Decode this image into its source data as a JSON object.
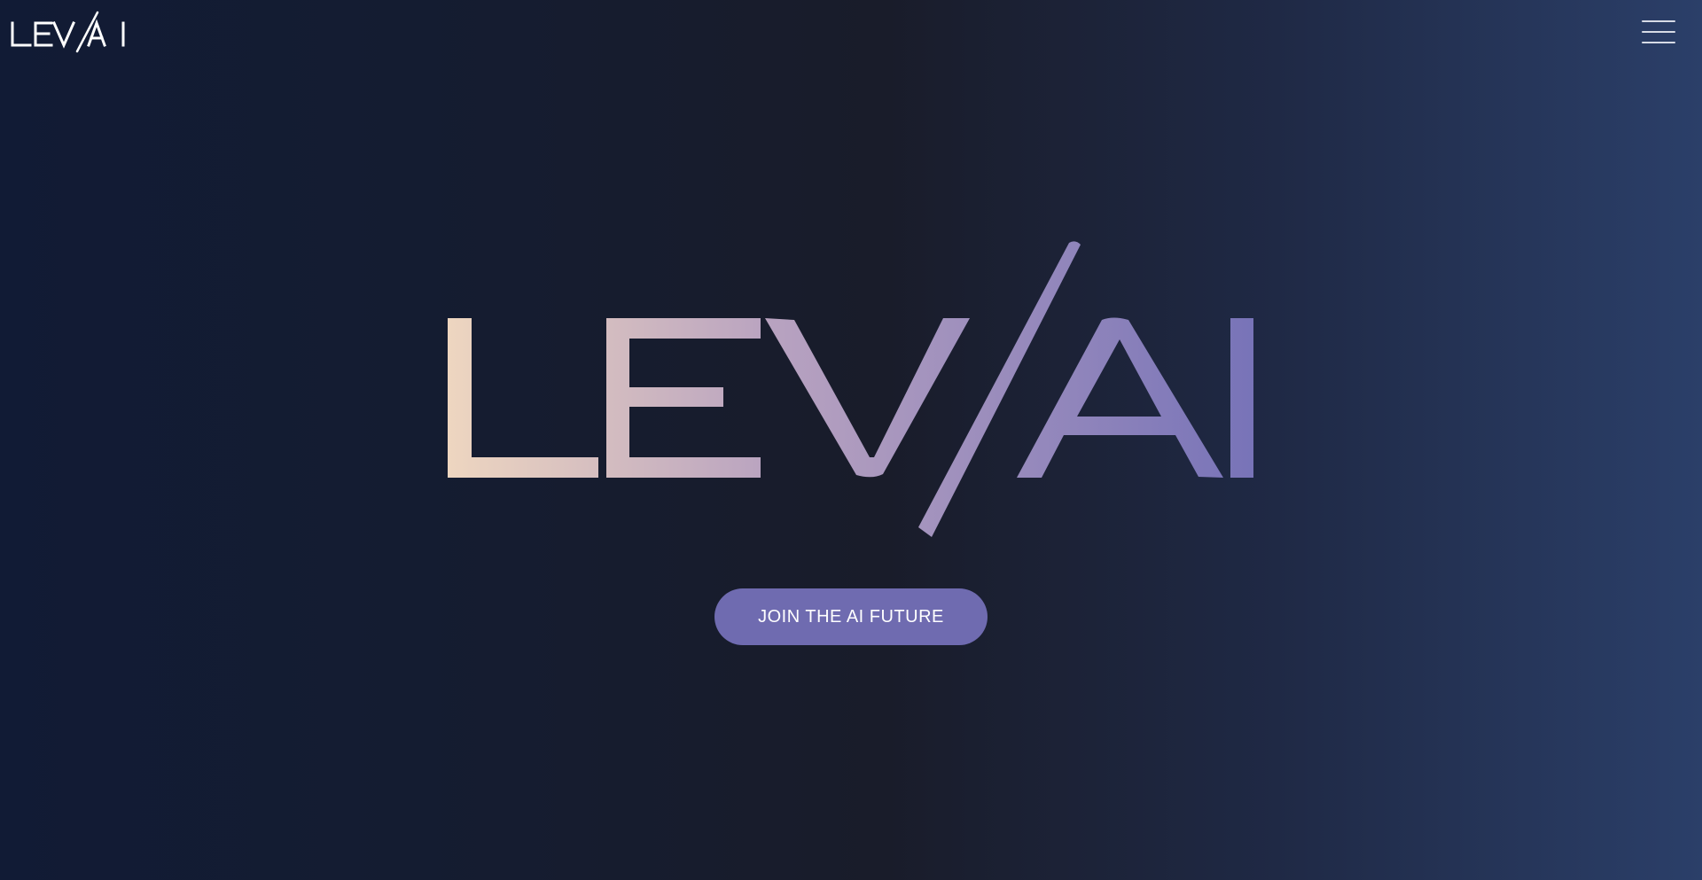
{
  "header": {
    "logo_text": "LEV/AI",
    "menu_icon": "hamburger-menu-icon"
  },
  "hero": {
    "logo_text": "LEV/AI",
    "cta_label": "JOIN THE AI FUTURE"
  },
  "colors": {
    "background_left": "#111b35",
    "background_mid": "#191c2a",
    "background_right": "#2b3f69",
    "logo_gradient_start": "#f0d8c0",
    "logo_gradient_mid": "#b9a3c0",
    "logo_gradient_end": "#7672b8",
    "cta_background": "#6f6bb0",
    "cta_text": "#ffffff"
  }
}
